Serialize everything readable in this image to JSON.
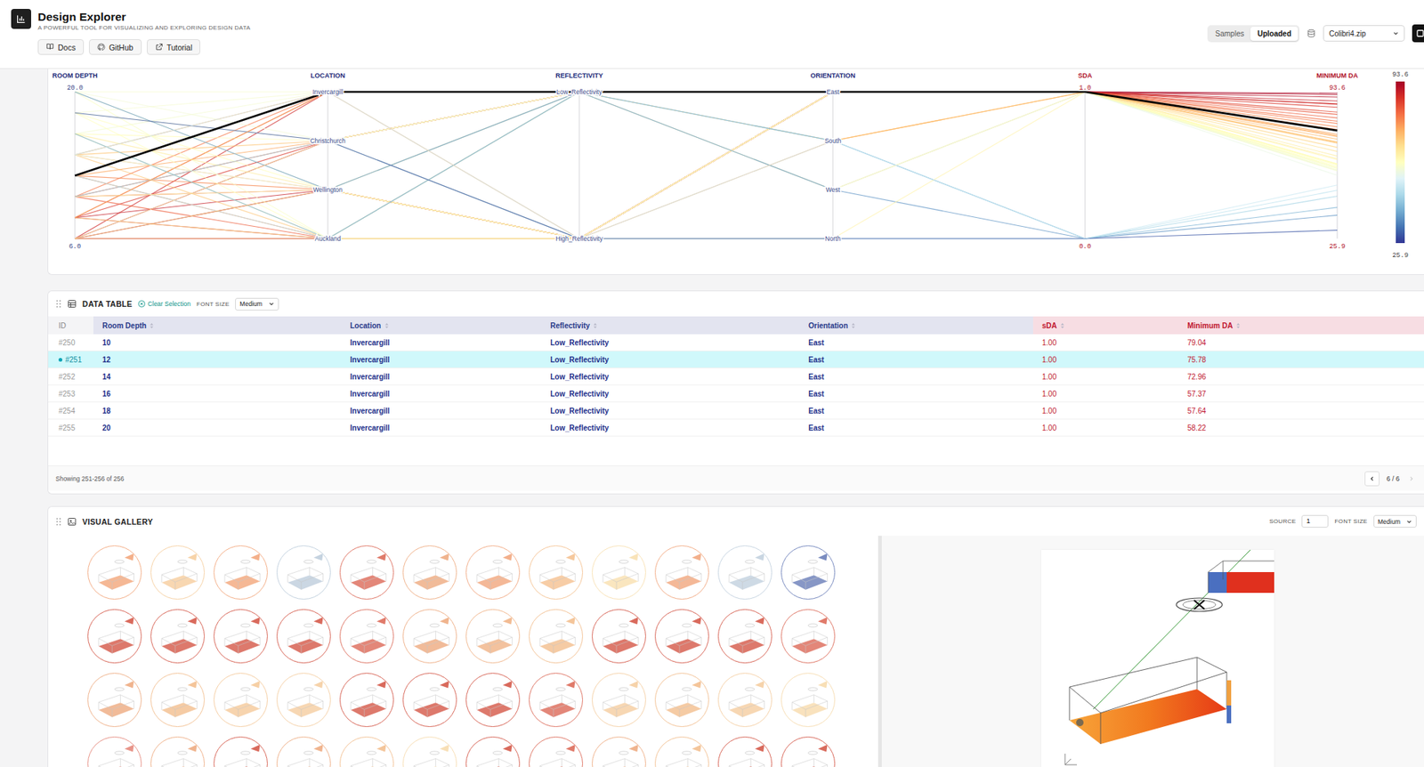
{
  "header": {
    "title": "Design Explorer",
    "subtitle": "A POWERFUL TOOL FOR VISUALIZING AND EXPLORING DESIGN DATA",
    "links": [
      {
        "label": "Docs"
      },
      {
        "label": "GitHub"
      },
      {
        "label": "Tutorial"
      }
    ],
    "source_tabs": [
      {
        "label": "Samples",
        "selected": false
      },
      {
        "label": "Uploaded",
        "selected": true
      }
    ],
    "dataset": "Colibri4.zip"
  },
  "chart": {
    "axes": [
      {
        "label": "ROOM DEPTH",
        "kind": "input",
        "type": "numeric",
        "min": 6,
        "max": 20,
        "top_tick": "20.0",
        "bottom_tick": "6.0"
      },
      {
        "label": "LOCATION",
        "kind": "input",
        "type": "category",
        "categories": [
          "Invercargill",
          "Christchurch",
          "Wellington",
          "Auckland"
        ]
      },
      {
        "label": "REFLECTIVITY",
        "kind": "input",
        "type": "category",
        "categories": [
          "Low_Reflectivity",
          "High_Reflectivity"
        ]
      },
      {
        "label": "ORIENTATION",
        "kind": "input",
        "type": "category",
        "categories": [
          "East",
          "South",
          "West",
          "North"
        ]
      },
      {
        "label": "SDA",
        "kind": "output",
        "type": "numeric",
        "min": 0,
        "max": 1,
        "top_tick": "1.0",
        "bottom_tick": "0.0"
      },
      {
        "label": "MINIMUM DA",
        "kind": "output",
        "type": "numeric",
        "min": 25.9,
        "max": 93.6,
        "top_tick": "93.6",
        "bottom_tick": "25.9"
      }
    ],
    "colorbar": {
      "max": "93.6",
      "min": "25.9"
    },
    "lines": [
      {
        "values": [
          6,
          "Invercargill",
          "Low_Reflectivity",
          "East",
          1.0,
          88.1
        ],
        "selected": false
      },
      {
        "values": [
          8,
          "Invercargill",
          "Low_Reflectivity",
          "East",
          1.0,
          84.3
        ],
        "selected": false
      },
      {
        "values": [
          10,
          "Invercargill",
          "Low_Reflectivity",
          "East",
          1.0,
          79.04
        ],
        "selected": false
      },
      {
        "values": [
          12,
          "Invercargill",
          "Low_Reflectivity",
          "East",
          1.0,
          75.78
        ],
        "selected": true
      },
      {
        "values": [
          14,
          "Invercargill",
          "Low_Reflectivity",
          "East",
          1.0,
          72.96
        ],
        "selected": false
      },
      {
        "values": [
          16,
          "Invercargill",
          "Low_Reflectivity",
          "East",
          1.0,
          57.37
        ],
        "selected": false
      },
      {
        "values": [
          18,
          "Invercargill",
          "Low_Reflectivity",
          "East",
          1.0,
          57.64
        ],
        "selected": false
      },
      {
        "values": [
          20,
          "Invercargill",
          "Low_Reflectivity",
          "East",
          1.0,
          58.22
        ],
        "selected": false
      },
      {
        "values": [
          6,
          "Christchurch",
          "Low_Reflectivity",
          "East",
          1.0,
          91.2
        ],
        "selected": false
      },
      {
        "values": [
          8,
          "Christchurch",
          "Low_Reflectivity",
          "East",
          1.0,
          86.5
        ],
        "selected": false
      },
      {
        "values": [
          10,
          "Christchurch",
          "Low_Reflectivity",
          "East",
          1.0,
          80.1
        ],
        "selected": false
      },
      {
        "values": [
          12,
          "Christchurch",
          "Low_Reflectivity",
          "East",
          1.0,
          74.0
        ],
        "selected": false
      },
      {
        "values": [
          14,
          "Christchurch",
          "Low_Reflectivity",
          "East",
          1.0,
          70.2
        ],
        "selected": false
      },
      {
        "values": [
          16,
          "Christchurch",
          "Low_Reflectivity",
          "East",
          1.0,
          60.3
        ],
        "selected": false
      },
      {
        "values": [
          18,
          "Christchurch",
          "Low_Reflectivity",
          "East",
          1.0,
          58.9
        ],
        "selected": false
      },
      {
        "values": [
          20,
          "Christchurch",
          "Low_Reflectivity",
          "East",
          1.0,
          57.1
        ],
        "selected": false
      },
      {
        "values": [
          6,
          "Wellington",
          "High_Reflectivity",
          "East",
          1.0,
          93.0
        ],
        "selected": false
      },
      {
        "values": [
          8,
          "Wellington",
          "High_Reflectivity",
          "East",
          1.0,
          89.4
        ],
        "selected": false
      },
      {
        "values": [
          10,
          "Wellington",
          "High_Reflectivity",
          "East",
          1.0,
          83.2
        ],
        "selected": false
      },
      {
        "values": [
          12,
          "Wellington",
          "High_Reflectivity",
          "East",
          1.0,
          77.5
        ],
        "selected": false
      },
      {
        "values": [
          14,
          "Wellington",
          "High_Reflectivity",
          "East",
          1.0,
          71.8
        ],
        "selected": false
      },
      {
        "values": [
          16,
          "Wellington",
          "High_Reflectivity",
          "East",
          1.0,
          64.0
        ],
        "selected": false
      },
      {
        "values": [
          18,
          "Wellington",
          "High_Reflectivity",
          "East",
          1.0,
          60.2
        ],
        "selected": false
      },
      {
        "values": [
          20,
          "Wellington",
          "High_Reflectivity",
          "East",
          1.0,
          59.0
        ],
        "selected": false
      },
      {
        "values": [
          6,
          "Auckland",
          "High_Reflectivity",
          "East",
          1.0,
          92.4
        ],
        "selected": false
      },
      {
        "values": [
          8,
          "Auckland",
          "High_Reflectivity",
          "East",
          1.0,
          87.9
        ],
        "selected": false
      },
      {
        "values": [
          10,
          "Auckland",
          "High_Reflectivity",
          "East",
          1.0,
          81.6
        ],
        "selected": false
      },
      {
        "values": [
          12,
          "Auckland",
          "High_Reflectivity",
          "East",
          1.0,
          76.2
        ],
        "selected": false
      },
      {
        "values": [
          14,
          "Auckland",
          "High_Reflectivity",
          "East",
          1.0,
          69.9
        ],
        "selected": false
      },
      {
        "values": [
          16,
          "Auckland",
          "High_Reflectivity",
          "East",
          1.0,
          62.8
        ],
        "selected": false
      },
      {
        "values": [
          18,
          "Auckland",
          "High_Reflectivity",
          "East",
          1.0,
          59.7
        ],
        "selected": false
      },
      {
        "values": [
          20,
          "Auckland",
          "High_Reflectivity",
          "East",
          1.0,
          58.4
        ],
        "selected": false
      },
      {
        "values": [
          6,
          "Auckland",
          "Low_Reflectivity",
          "South",
          1.0,
          70.5
        ],
        "selected": false
      },
      {
        "values": [
          8,
          "Auckland",
          "Low_Reflectivity",
          "South",
          1.0,
          66.1
        ],
        "selected": false
      },
      {
        "values": [
          12,
          "Auckland",
          "Low_Reflectivity",
          "South",
          0.0,
          48.2
        ],
        "selected": false
      },
      {
        "values": [
          16,
          "Auckland",
          "Low_Reflectivity",
          "South",
          0.0,
          40.3
        ],
        "selected": false
      },
      {
        "values": [
          6,
          "Wellington",
          "Low_Reflectivity",
          "West",
          1.0,
          68.0
        ],
        "selected": false
      },
      {
        "values": [
          10,
          "Wellington",
          "Low_Reflectivity",
          "West",
          1.0,
          60.4
        ],
        "selected": false
      },
      {
        "values": [
          14,
          "Wellington",
          "Low_Reflectivity",
          "West",
          1.0,
          55.1
        ],
        "selected": false
      },
      {
        "values": [
          20,
          "Wellington",
          "Low_Reflectivity",
          "West",
          0.0,
          36.7
        ],
        "selected": false
      },
      {
        "values": [
          6,
          "Christchurch",
          "High_Reflectivity",
          "North",
          1.0,
          62.3
        ],
        "selected": false
      },
      {
        "values": [
          10,
          "Christchurch",
          "High_Reflectivity",
          "North",
          0.0,
          45.5
        ],
        "selected": false
      },
      {
        "values": [
          18,
          "Christchurch",
          "High_Reflectivity",
          "North",
          0.0,
          29.8
        ],
        "selected": false
      },
      {
        "values": [
          8,
          "Invercargill",
          "High_Reflectivity",
          "South",
          1.0,
          73.4
        ],
        "selected": false
      },
      {
        "values": [
          14,
          "Invercargill",
          "High_Reflectivity",
          "South",
          0.0,
          50.6
        ],
        "selected": false
      }
    ]
  },
  "table": {
    "title": "DATA TABLE",
    "clear": "Clear Selection",
    "font_size_label": "FONT SIZE",
    "font_size": "Medium",
    "columns": [
      {
        "label": "ID",
        "kind": "id"
      },
      {
        "label": "Room Depth",
        "kind": "input"
      },
      {
        "label": "Location",
        "kind": "input"
      },
      {
        "label": "Reflectivity",
        "kind": "input"
      },
      {
        "label": "Orientation",
        "kind": "input"
      },
      {
        "label": "sDA",
        "kind": "output"
      },
      {
        "label": "Minimum DA",
        "kind": "output"
      }
    ],
    "rows": [
      {
        "cells": [
          "#250",
          "10",
          "Invercargill",
          "Low_Reflectivity",
          "East",
          "1.00",
          "79.04"
        ],
        "selected": false
      },
      {
        "cells": [
          "#251",
          "12",
          "Invercargill",
          "Low_Reflectivity",
          "East",
          "1.00",
          "75.78"
        ],
        "selected": true
      },
      {
        "cells": [
          "#252",
          "14",
          "Invercargill",
          "Low_Reflectivity",
          "East",
          "1.00",
          "72.96"
        ],
        "selected": false
      },
      {
        "cells": [
          "#253",
          "16",
          "Invercargill",
          "Low_Reflectivity",
          "East",
          "1.00",
          "57.37"
        ],
        "selected": false
      },
      {
        "cells": [
          "#254",
          "18",
          "Invercargill",
          "Low_Reflectivity",
          "East",
          "1.00",
          "57.64"
        ],
        "selected": false
      },
      {
        "cells": [
          "#255",
          "20",
          "Invercargill",
          "Low_Reflectivity",
          "East",
          "1.00",
          "58.22"
        ],
        "selected": false
      }
    ],
    "footer": "Showing 251-256 of 256",
    "page": "6 / 6"
  },
  "gallery": {
    "title": "VISUAL GALLERY",
    "source_label": "SOURCE",
    "source": "1",
    "font_size_label": "FONT SIZE",
    "font_size": "Medium",
    "items": [
      {
        "color": "#f4b08a"
      },
      {
        "color": "#f7d3a8"
      },
      {
        "color": "#f4b08a"
      },
      {
        "color": "#c5d3e0"
      },
      {
        "color": "#e07a6a"
      },
      {
        "color": "#f0b48e"
      },
      {
        "color": "#f3b08c"
      },
      {
        "color": "#f6c89c"
      },
      {
        "color": "#f9e3b8"
      },
      {
        "color": "#f3b08c"
      },
      {
        "color": "#c9d6e2"
      },
      {
        "color": "#7a8cc0"
      },
      {
        "color": "#d96a5c"
      },
      {
        "color": "#d96a5c"
      },
      {
        "color": "#d96a5c"
      },
      {
        "color": "#d96a5c"
      },
      {
        "color": "#e07a6a"
      },
      {
        "color": "#f0b48e"
      },
      {
        "color": "#f2bb93"
      },
      {
        "color": "#f4c59a"
      },
      {
        "color": "#d96a5c"
      },
      {
        "color": "#d96a5c"
      },
      {
        "color": "#d96a5c"
      },
      {
        "color": "#e07a6a"
      },
      {
        "color": "#f0b48e"
      },
      {
        "color": "#f4c59a"
      },
      {
        "color": "#f6cfa5"
      },
      {
        "color": "#f6d3ab"
      },
      {
        "color": "#d96a5c"
      },
      {
        "color": "#d96a5c"
      },
      {
        "color": "#d96a5c"
      },
      {
        "color": "#e07a6a"
      },
      {
        "color": "#f6d3ab"
      },
      {
        "color": "#f4c59a"
      },
      {
        "color": "#f6d3ab"
      },
      {
        "color": "#f8dfb6"
      },
      {
        "color": "#e8958a"
      },
      {
        "color": "#f0b48e"
      },
      {
        "color": "#d96a5c"
      },
      {
        "color": "#f0b48e"
      },
      {
        "color": "#f4c59a"
      },
      {
        "color": "#f8dfb6"
      },
      {
        "color": "#d96a5c"
      },
      {
        "color": "#e07a6a"
      },
      {
        "color": "#f0b48e"
      },
      {
        "color": "#f4c59a"
      },
      {
        "color": "#d96a5c"
      },
      {
        "color": "#d96a5c"
      }
    ]
  }
}
